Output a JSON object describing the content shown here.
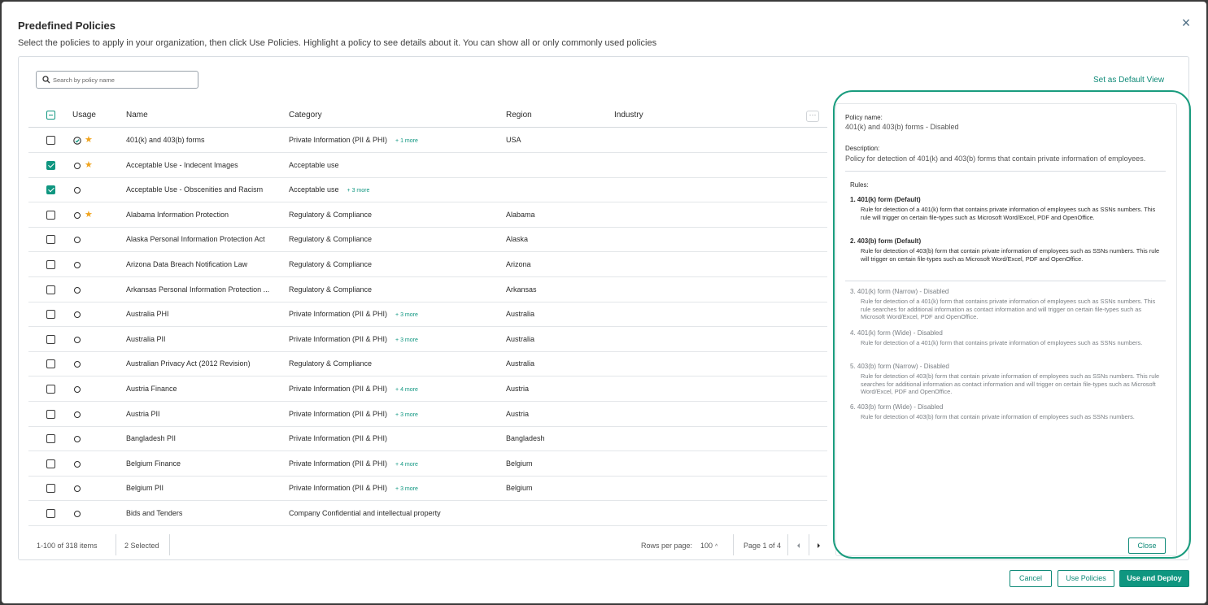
{
  "dialog": {
    "title": "Predefined Policies",
    "subtitle": "Select the policies to apply in your organization, then click Use Policies. Highlight a policy to see details about it. You can show all or only commonly used policies",
    "close_icon": "close-icon"
  },
  "search": {
    "placeholder": "Search by policy name"
  },
  "set_default_view": "Set as Default View",
  "table": {
    "headers": {
      "usage": "Usage",
      "name": "Name",
      "category": "Category",
      "region": "Region",
      "industry": "Industry"
    },
    "menu_icon": "more-horizontal-icon",
    "rows": [
      {
        "checked": false,
        "usage": "check",
        "starred": true,
        "name": "401(k) and 403(b) forms",
        "category": "Private Information (PII & PHI)",
        "more": "+ 1 more",
        "region": "USA"
      },
      {
        "checked": true,
        "usage": "circle",
        "starred": true,
        "name": "Acceptable Use - Indecent Images",
        "category": "Acceptable use",
        "more": "",
        "region": ""
      },
      {
        "checked": true,
        "usage": "circle",
        "starred": false,
        "name": "Acceptable Use - Obscenities and Racism",
        "category": "Acceptable use",
        "more": "+ 3 more",
        "region": ""
      },
      {
        "checked": false,
        "usage": "circle",
        "starred": true,
        "name": "Alabama Information Protection",
        "category": "Regulatory & Compliance",
        "more": "",
        "region": "Alabama"
      },
      {
        "checked": false,
        "usage": "circle",
        "starred": false,
        "name": "Alaska Personal Information Protection Act",
        "category": "Regulatory & Compliance",
        "more": "",
        "region": "Alaska"
      },
      {
        "checked": false,
        "usage": "circle",
        "starred": false,
        "name": "Arizona Data Breach Notification Law",
        "category": "Regulatory & Compliance",
        "more": "",
        "region": "Arizona"
      },
      {
        "checked": false,
        "usage": "circle",
        "starred": false,
        "name": "Arkansas Personal Information Protection ...",
        "category": "Regulatory & Compliance",
        "more": "",
        "region": "Arkansas"
      },
      {
        "checked": false,
        "usage": "circle",
        "starred": false,
        "name": "Australia PHI",
        "category": "Private Information (PII & PHI)",
        "more": "+ 3 more",
        "region": "Australia"
      },
      {
        "checked": false,
        "usage": "circle",
        "starred": false,
        "name": "Australia PII",
        "category": "Private Information (PII & PHI)",
        "more": "+ 3 more",
        "region": "Australia"
      },
      {
        "checked": false,
        "usage": "circle",
        "starred": false,
        "name": "Australian Privacy Act (2012 Revision)",
        "category": "Regulatory & Compliance",
        "more": "",
        "region": "Australia"
      },
      {
        "checked": false,
        "usage": "circle",
        "starred": false,
        "name": "Austria Finance",
        "category": "Private Information (PII & PHI)",
        "more": "+ 4 more",
        "region": "Austria"
      },
      {
        "checked": false,
        "usage": "circle",
        "starred": false,
        "name": "Austria PII",
        "category": "Private Information (PII & PHI)",
        "more": "+ 3 more",
        "region": "Austria"
      },
      {
        "checked": false,
        "usage": "circle",
        "starred": false,
        "name": "Bangladesh PII",
        "category": "Private Information (PII & PHI)",
        "more": "",
        "region": "Bangladesh"
      },
      {
        "checked": false,
        "usage": "circle",
        "starred": false,
        "name": "Belgium Finance",
        "category": "Private Information (PII & PHI)",
        "more": "+ 4 more",
        "region": "Belgium"
      },
      {
        "checked": false,
        "usage": "circle",
        "starred": false,
        "name": "Belgium PII",
        "category": "Private Information (PII & PHI)",
        "more": "+ 3 more",
        "region": "Belgium"
      },
      {
        "checked": false,
        "usage": "circle",
        "starred": false,
        "name": "Bids and Tenders",
        "category": "Company Confidential and intellectual property",
        "more": "",
        "region": ""
      }
    ]
  },
  "footer": {
    "range": "1-100 of 318 items",
    "selected": "2 Selected",
    "rows_per_page_label": "Rows per page:",
    "rows_per_page_value": "100",
    "page": "Page 1 of 4"
  },
  "details": {
    "policy_name_label": "Policy name:",
    "policy_name_value": "401(k) and 403(b) forms - Disabled",
    "description_label": "Description:",
    "description_value": "Policy for detection of 401(k) and 403(b) forms that contain private information of employees.",
    "rules_label": "Rules:",
    "rules": [
      {
        "title": "1. 401(k) form (Default)",
        "suffix": "",
        "desc": "Rule for detection of a 401(k) form that contains private information of employees such as SSNs numbers. This rule will trigger on certain file-types such as Microsoft Word/Excel, PDF and OpenOffice."
      },
      {
        "title": "2. 403(b) form (Default)",
        "suffix": "",
        "desc": "Rule for detection of 403(b) form that contain private information of employees such as SSNs numbers. This rule will trigger on certain file-types such as Microsoft Word/Excel, PDF and OpenOffice."
      },
      {
        "title": "3. 401(k) form (Narrow)",
        "suffix": " - Disabled",
        "desc": "Rule for detection of a 401(k) form that contains private information of employees such as SSNs numbers. This rule searches for additional information as contact information and will trigger on certain file-types such as Microsoft Word/Excel, PDF and OpenOffice."
      },
      {
        "title": "4. 401(k) form (Wide)",
        "suffix": " - Disabled",
        "desc": "Rule for detection of a 401(k) form that contains private information of employees such as SSNs numbers."
      },
      {
        "title": "5. 403(b) form (Narrow)",
        "suffix": " - Disabled",
        "desc": "Rule for detection of 403(b) form that contain private information of employees such as SSNs numbers. This rule searches for additional information as contact information and will trigger on certain file-types such as Microsoft Word/Excel, PDF and OpenOffice."
      },
      {
        "title": "6. 403(b) form (Wide)",
        "suffix": " - Disabled",
        "desc": "Rule for detection of 403(b) form that contain private information of employees such as SSNs numbers."
      }
    ],
    "close_label": "Close"
  },
  "buttons": {
    "cancel": "Cancel",
    "use_policies": "Use Policies",
    "use_and_deploy": "Use and Deploy"
  },
  "colors": {
    "accent": "#0f9680",
    "highlight": "#1a9c7e",
    "star": "#f0a31c"
  }
}
